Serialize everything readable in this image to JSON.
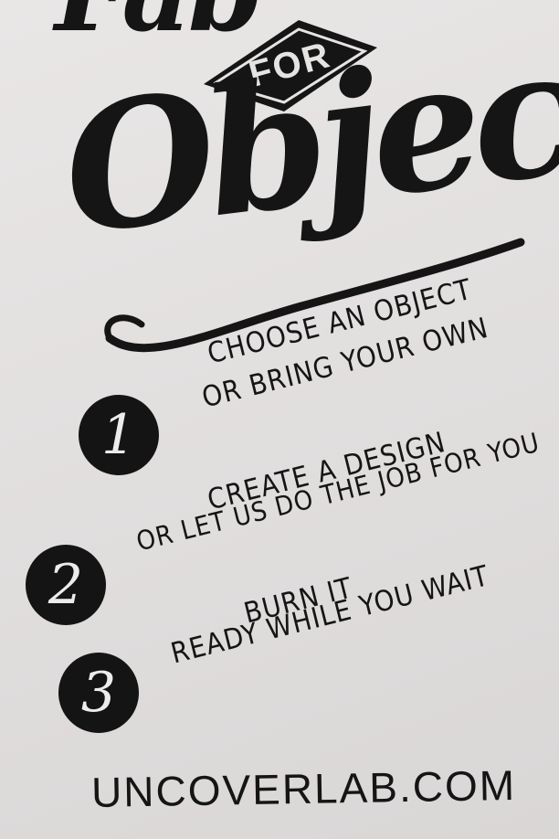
{
  "sign": {
    "header_top_partial": "Fab",
    "header_badge": "FOR",
    "header_main": "Objects"
  },
  "steps": [
    {
      "number": "1",
      "line1": "CHOOSE AN OBJECT",
      "line2": "OR BRING YOUR OWN"
    },
    {
      "number": "2",
      "line1": "CREATE A DESIGN",
      "line2": "OR LET US DO THE JOB FOR YOU"
    },
    {
      "number": "3",
      "line1": "BURN IT",
      "line2": "READY WHILE YOU WAIT"
    }
  ],
  "website": "UNCOVERLAB.COM",
  "colors": {
    "ink": "#151515",
    "wall": "#e4e1e1"
  }
}
